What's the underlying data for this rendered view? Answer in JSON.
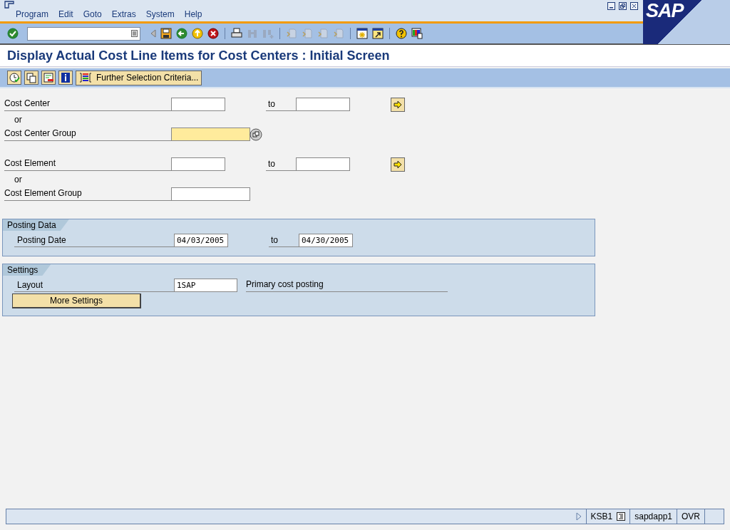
{
  "menu": [
    "Program",
    "Edit",
    "Goto",
    "Extras",
    "System",
    "Help"
  ],
  "logo": "SAP",
  "title": "Display Actual Cost Line Items for Cost Centers : Initial Screen",
  "app_toolbar": {
    "button": "Further Selection Criteria..."
  },
  "selection": [
    {
      "kind": "range",
      "label": "Cost Center",
      "to_label": "to"
    },
    {
      "kind": "or",
      "label": "or"
    },
    {
      "kind": "group",
      "label": "Cost Center Group",
      "highlighted": true
    },
    {
      "kind": "spacer"
    },
    {
      "kind": "range",
      "label": "Cost Element",
      "to_label": "to"
    },
    {
      "kind": "or",
      "label": "or"
    },
    {
      "kind": "group",
      "label": "Cost Element Group",
      "highlighted": false
    }
  ],
  "posting_data": {
    "title": "Posting Data",
    "label": "Posting Date",
    "from": "04/03/2005",
    "to_label": "to",
    "to": "04/30/2005"
  },
  "settings": {
    "title": "Settings",
    "label": "Layout",
    "value": "1SAP",
    "description": "Primary cost posting",
    "button": "More Settings"
  },
  "status_bar": {
    "transaction": "KSB1",
    "server": "sapdapp1",
    "mode": "OVR"
  }
}
